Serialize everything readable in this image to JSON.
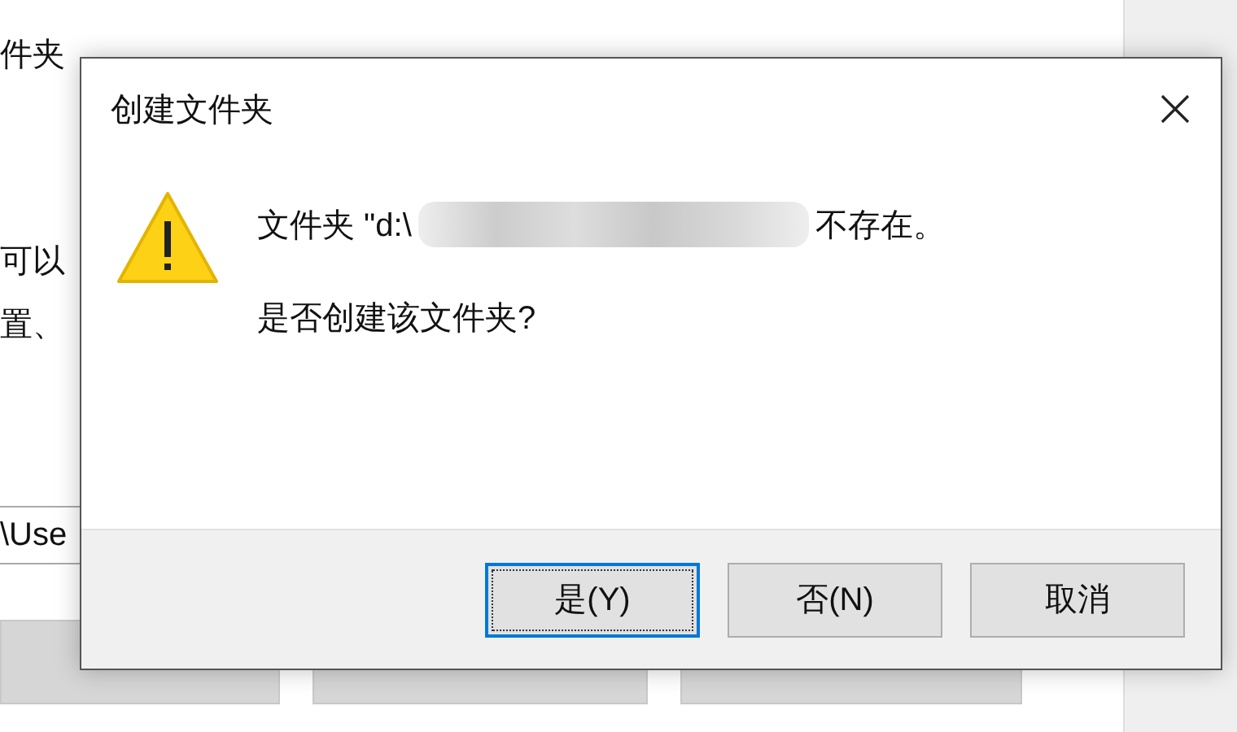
{
  "background_window": {
    "heading": "件夹",
    "lines": [
      "可以",
      "置、"
    ],
    "path_field": {
      "value": "\\Use"
    }
  },
  "dialog": {
    "title": "创建文件夹",
    "message": {
      "prefix": "文件夹 \"d:\\",
      "suffix": "不存在。"
    },
    "question": "是否创建该文件夹?",
    "buttons": [
      {
        "label": "是(Y)",
        "selected": true
      },
      {
        "label": "否(N)",
        "selected": false
      },
      {
        "label": "取消",
        "selected": false
      }
    ]
  }
}
